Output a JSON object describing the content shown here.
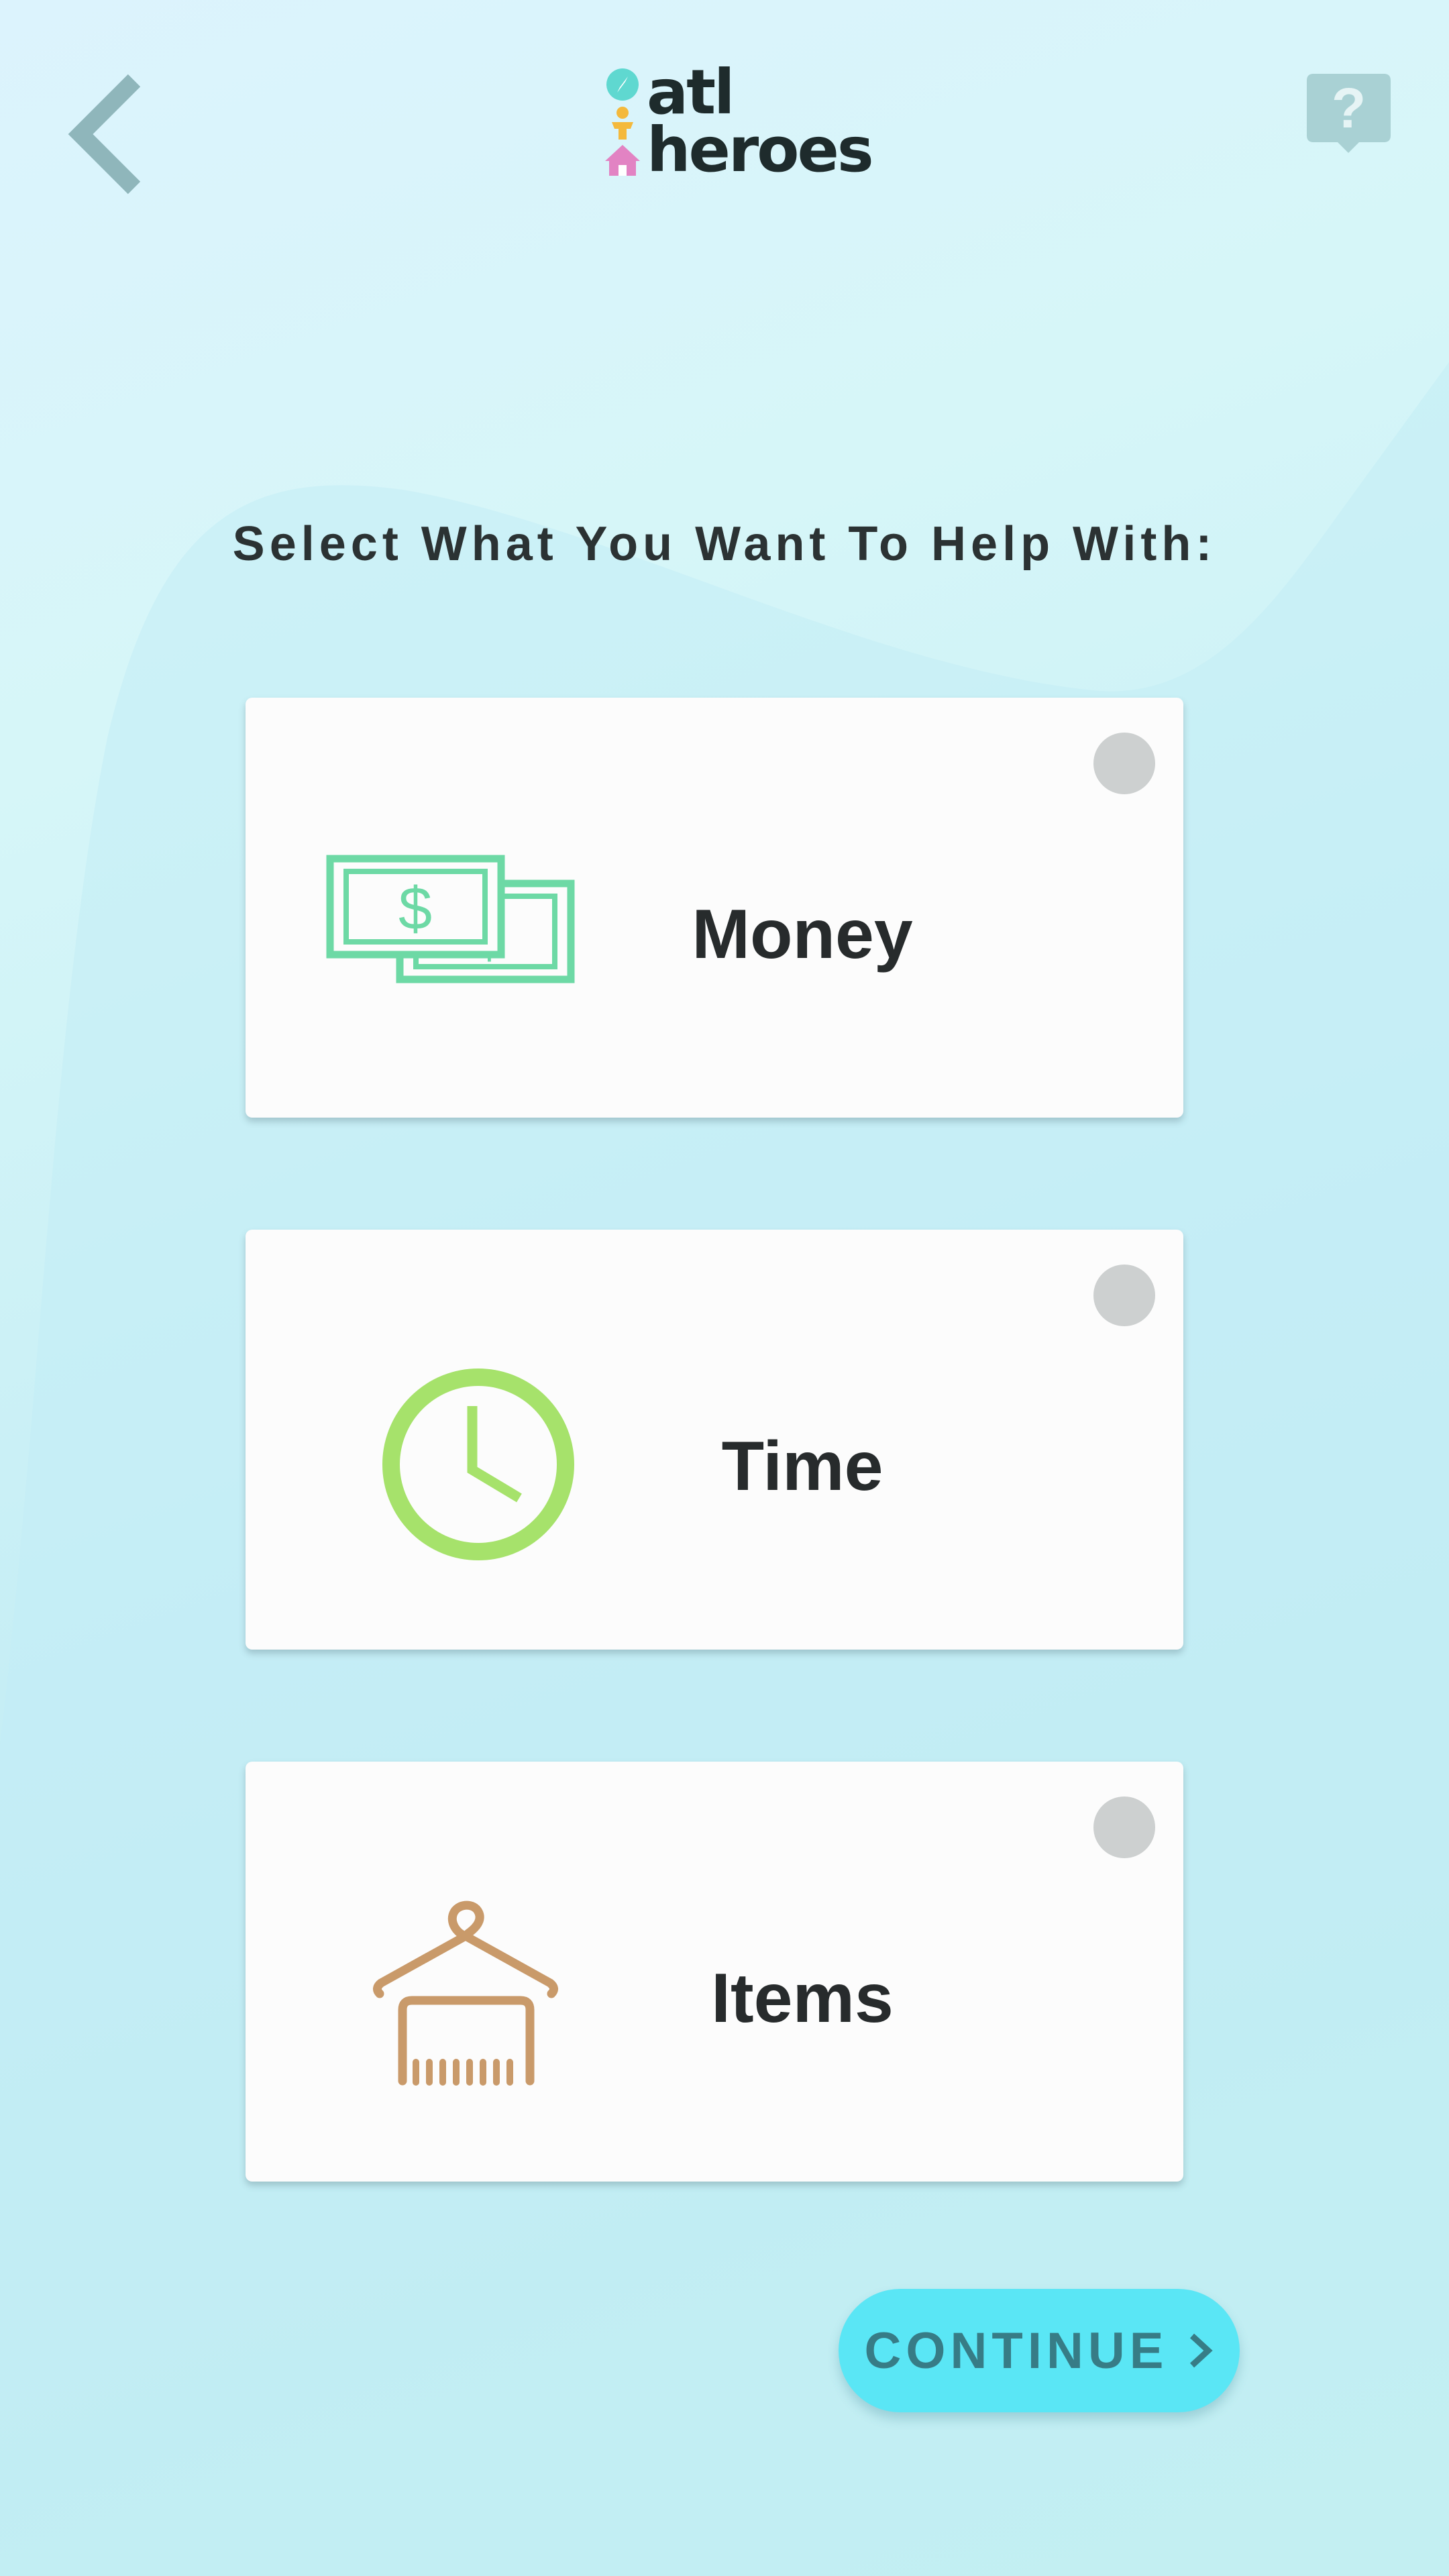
{
  "header": {
    "back_icon": "chevron-left-icon",
    "help_icon": "question-bubble-icon",
    "logo": {
      "line1": "atl",
      "line2": "heroes",
      "icons": [
        "compass-icon",
        "person-icon",
        "house-icon"
      ]
    }
  },
  "prompt": {
    "title": "Select What You Want To Help With:"
  },
  "options": [
    {
      "label": "Money",
      "icon": "money-bills-icon",
      "selected": false,
      "icon_color": "#6dd9a5"
    },
    {
      "label": "Time",
      "icon": "clock-icon",
      "selected": false,
      "icon_color": "#a6e26b"
    },
    {
      "label": "Items",
      "icon": "clothes-hanger-icon",
      "selected": false,
      "icon_color": "#c99a6a"
    }
  ],
  "continue_button": {
    "label": "CONTINUE",
    "icon": "chevron-right-icon"
  },
  "colors": {
    "accent": "#5ae6f5",
    "accent_text": "#377c86",
    "radio_unselected": "#cdd0d0",
    "nav_icon": "#8fb6bb"
  }
}
